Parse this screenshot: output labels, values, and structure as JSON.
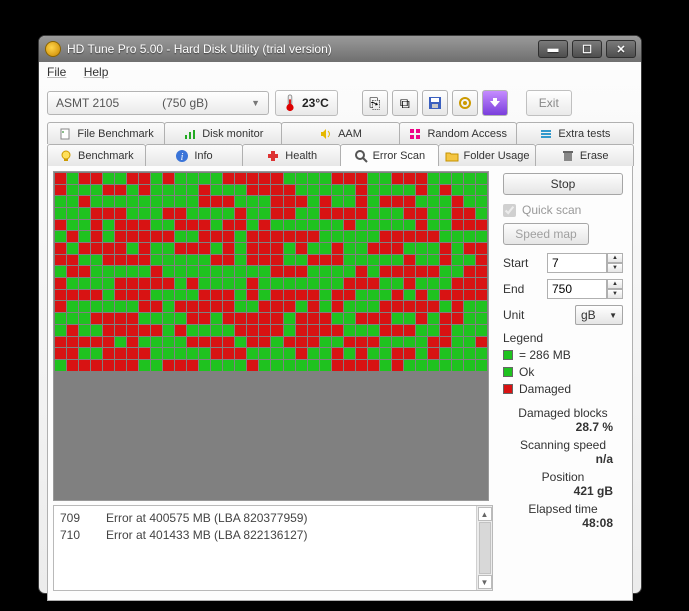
{
  "title": "HD Tune Pro 5.00 - Hard Disk Utility (trial version)",
  "menu": {
    "file": "File",
    "help": "Help"
  },
  "drive": {
    "name": "ASMT 2105",
    "size": "(750 gB)"
  },
  "temperature": "23°C",
  "exit": "Exit",
  "toolbar_icons": [
    "copy-icon",
    "copy-multi-icon",
    "save-icon",
    "options-icon",
    "down-arrow-icon"
  ],
  "tabs_row1": [
    {
      "label": "File Benchmark",
      "icon": "doc-icon"
    },
    {
      "label": "Disk monitor",
      "icon": "chart-icon"
    },
    {
      "label": "AAM",
      "icon": "speaker-icon"
    },
    {
      "label": "Random Access",
      "icon": "grid-icon"
    },
    {
      "label": "Extra tests",
      "icon": "list-icon"
    }
  ],
  "tabs_row2": [
    {
      "label": "Benchmark",
      "icon": "bulb-icon"
    },
    {
      "label": "Info",
      "icon": "info-icon"
    },
    {
      "label": "Health",
      "icon": "health-icon"
    },
    {
      "label": "Error Scan",
      "icon": "magnify-icon",
      "active": true
    },
    {
      "label": "Folder Usage",
      "icon": "folder-icon"
    },
    {
      "label": "Erase",
      "icon": "trash-icon"
    }
  ],
  "controls": {
    "stop": "Stop",
    "quick_scan": "Quick scan",
    "speed_map": "Speed map",
    "start_lbl": "Start",
    "start_val": "7",
    "end_lbl": "End",
    "end_val": "750",
    "unit_lbl": "Unit",
    "unit_val": "gB"
  },
  "legend": {
    "title": "Legend",
    "blocksize": "= 286 MB",
    "ok": "Ok",
    "damaged": "Damaged"
  },
  "stats": {
    "dmg_lbl": "Damaged blocks",
    "dmg_val": "28.7 %",
    "speed_lbl": "Scanning speed",
    "speed_val": "n/a",
    "pos_lbl": "Position",
    "pos_val": "421 gB",
    "time_lbl": "Elapsed time",
    "time_val": "48:08"
  },
  "log": [
    {
      "n": "709",
      "t": "Error at 400575 MB (LBA 820377959)"
    },
    {
      "n": "710",
      "t": "Error at 401433 MB (LBA 822136127)"
    }
  ],
  "map": "rgrrggrrgrggggrrrrrggggrrrggrrrgggggrgggrrgrggggrgggrrrrgggggrggggrgrgggggrgggggggggrrrgggrrrgrggrgrrrgggrgggggrrrgggrrggggrggrrggrrrrgggrrggrrgrggrgrrrggrrrgrrgrggggggrgggggrggrrrgrgrgrrrrrggrrrgrrrrrrgggggrrrrrggggrgrrrrgrggrrrgrgrrrgrggrggrrrgggrgrrrrggrrrrgggggrrgrrrggrrrgggggrggrggrgrrgggggrgggggggggrrrggggrgrrrrrggrrrggggrrrrrgrggggrgggggggrrrggrgggrrrrrrrgrrrggggrrrgrgrrrrgrrgggrgrgrrrrrggggggrrgrrrrrggrrrgrgrgggrrrrrgrgggggrrrrggggrrgrrrrrgrrrggrrrggrgrrgggrggrrrrrgrggggrrrrgrrrrgggrrrggrgggrrrrrgrggggrrrrgrrgrrrggrrrggggrrggrrrggrrrrgggggrrrggggrggrgrggrrgrgggggrrrrrrggrrrggggrggggggrrrrgrggggggggr"
}
